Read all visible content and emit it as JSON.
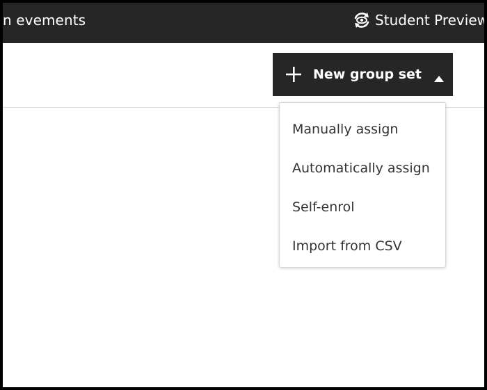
{
  "topbar": {
    "left_text": "n evements",
    "student_preview_label": "Student Preview",
    "student_preview_icon": "refresh-eye-icon"
  },
  "toolbar": {
    "new_group_set_label": "New group set",
    "plus_icon": "plus-icon",
    "caret_icon": "caret-up-icon"
  },
  "dropdown": {
    "items": [
      {
        "label": "Manually assign"
      },
      {
        "label": "Automatically assign"
      },
      {
        "label": "Self-enrol"
      },
      {
        "label": "Import from CSV"
      }
    ]
  },
  "colors": {
    "topbar_bg": "#262626",
    "button_bg": "#262626",
    "menu_text": "#333333",
    "page_bg": "#ffffff"
  }
}
